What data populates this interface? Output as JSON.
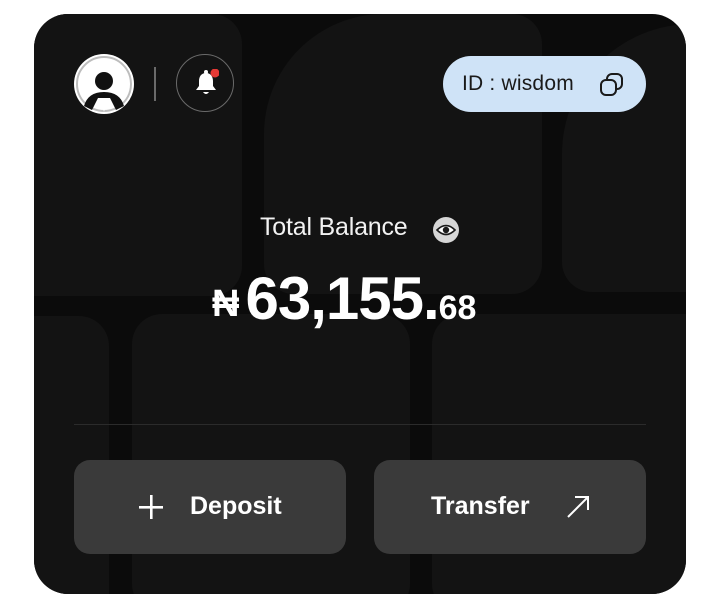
{
  "profile": {
    "avatar_alt": "user avatar"
  },
  "notifications": {
    "has_unread": true
  },
  "account_id": {
    "label": "ID : wisdom"
  },
  "balance": {
    "label": "Total Balance",
    "currency_symbol": "₦",
    "major": "63,155.",
    "minor": "68"
  },
  "actions": {
    "deposit_label": "Deposit",
    "transfer_label": "Transfer"
  },
  "colors": {
    "card_background": "#0b0b0b",
    "id_pill": "#cfe3f7",
    "button": "#3a3a3a",
    "notification_dot": "#e53935"
  }
}
